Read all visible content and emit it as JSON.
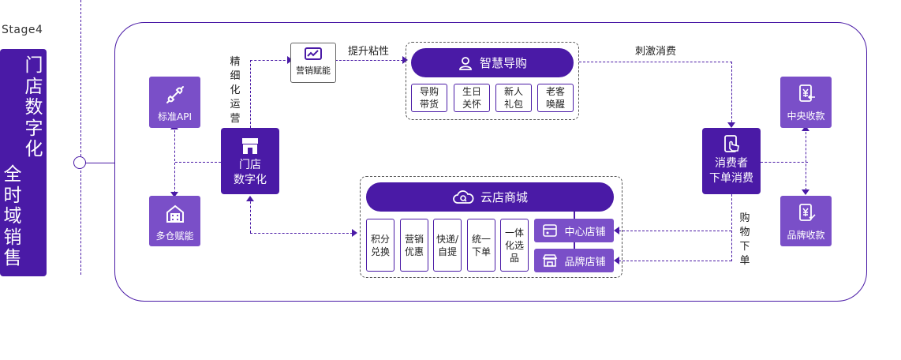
{
  "stage": {
    "label": "Stage4",
    "banner": [
      "门店数字化",
      "全时域销售"
    ]
  },
  "left": {
    "api_card": {
      "label": "标准API"
    },
    "warehouse_card": {
      "label": "多仓赋能"
    }
  },
  "store": {
    "label_line1": "门店",
    "label_line2": "数字化",
    "side_text": "精细化运营"
  },
  "marketing": {
    "label": "营销赋能",
    "to_smart_text": "提升粘性"
  },
  "smart": {
    "title": "智慧导购",
    "items": [
      {
        "line1": "导购",
        "line2": "带货"
      },
      {
        "line1": "生日",
        "line2": "关怀"
      },
      {
        "line1": "新人",
        "line2": "礼包"
      },
      {
        "line1": "老客",
        "line2": "唤醒"
      }
    ],
    "to_consumer_text": "刺激消费"
  },
  "cloud": {
    "title": "云店商城",
    "items": [
      {
        "lines": [
          "积分",
          "兑换"
        ]
      },
      {
        "lines": [
          "营销",
          "优惠"
        ]
      },
      {
        "lines": [
          "快递/",
          "自提"
        ]
      },
      {
        "lines": [
          "统一",
          "下单"
        ]
      },
      {
        "lines": [
          "一体",
          "化选",
          "品"
        ]
      }
    ],
    "center_store": "中心店铺",
    "brand_store": "品牌店铺"
  },
  "consumer": {
    "line1": "消费者",
    "line2": "下单消费",
    "side_text": "购物下单"
  },
  "right": {
    "central_collect": {
      "label": "中央收款"
    },
    "brand_collect": {
      "label": "品牌收款"
    }
  }
}
